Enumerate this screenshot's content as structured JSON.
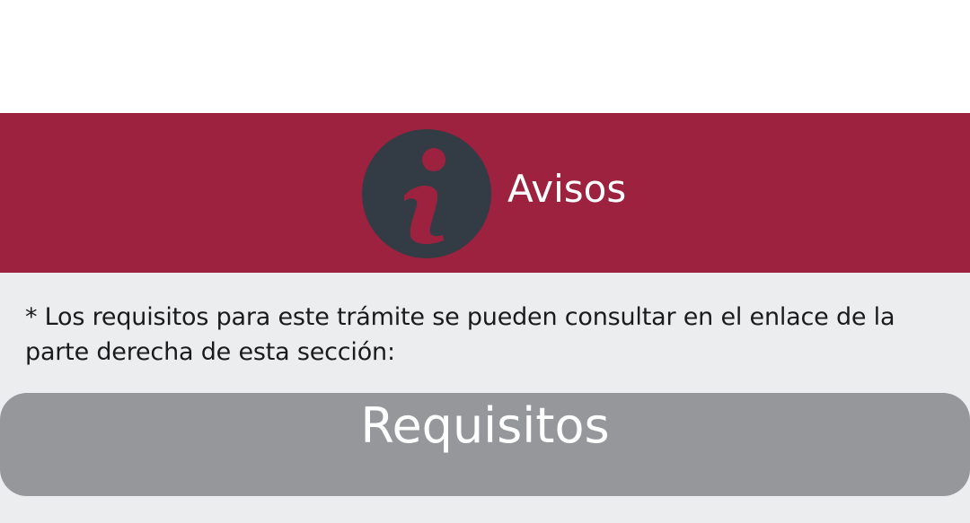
{
  "header": {
    "title": "Avisos",
    "icon": "info-icon",
    "background_color": "#9d223f",
    "icon_color": "#333b44"
  },
  "notice": {
    "text": "* Los requisitos para este trámite se pueden consultar en el enlace de la parte derecha de esta sección:"
  },
  "requirements_button": {
    "label": "Requisitos",
    "color": "#96979b"
  }
}
